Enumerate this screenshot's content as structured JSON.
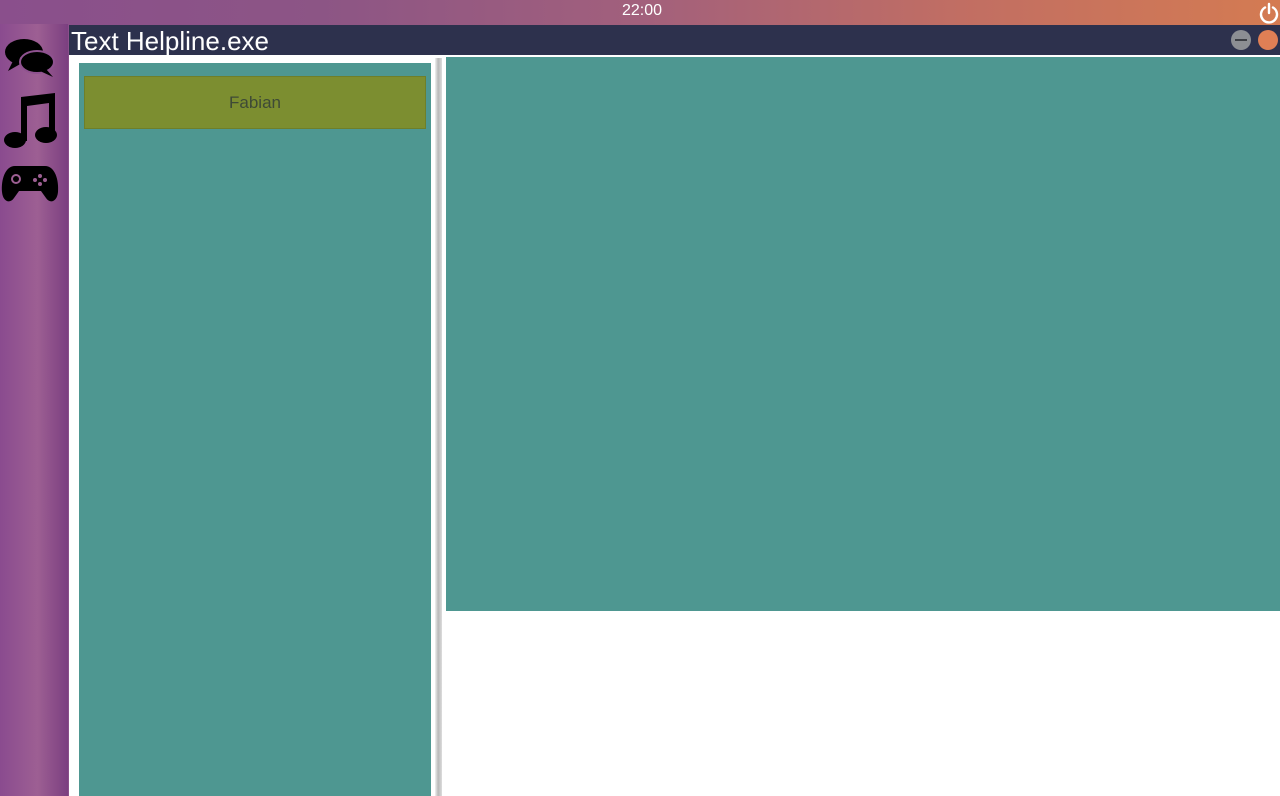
{
  "topbar": {
    "time": "22:00",
    "power_icon": "power-icon"
  },
  "dock": {
    "items": [
      {
        "icon": "chat-bubbles-icon"
      },
      {
        "icon": "music-note-icon"
      },
      {
        "icon": "gamepad-icon"
      }
    ]
  },
  "window": {
    "title": "Text Helpline.exe",
    "controls": [
      "minimize-icon",
      "close-icon"
    ],
    "contacts": [
      {
        "name": "Fabian"
      }
    ]
  },
  "colors": {
    "titlebar": "#2d314d",
    "panel": "#4e9791",
    "contact_selected": "#7c8e30",
    "close": "#e07f55",
    "minimize": "#8c8e93"
  }
}
